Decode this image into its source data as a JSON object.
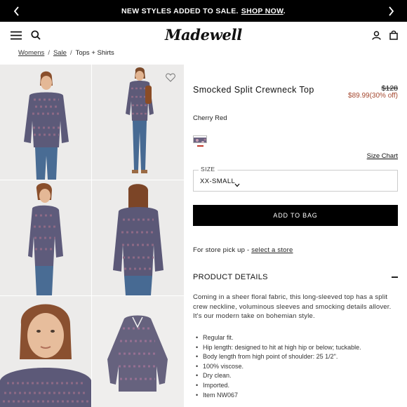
{
  "promo": {
    "text": "NEW STYLES ADDED TO SALE.",
    "link": "SHOP NOW",
    "suffix": "."
  },
  "header": {
    "logo": "Madewell",
    "icons": [
      "menu-icon",
      "search-icon",
      "account-icon",
      "bag-icon"
    ]
  },
  "breadcrumb": {
    "items": [
      "Womens",
      "Sale",
      "Tops + Shirts"
    ],
    "separator": "/"
  },
  "product": {
    "title": "Smocked Split Crewneck Top",
    "original_price": "$128",
    "sale_price": "$89.99(30% off)",
    "color_label": "Cherry Red",
    "size_chart": "Size Chart",
    "size_legend": "SIZE",
    "size_value": "XX-SMALL",
    "add_to_bag": "ADD TO BAG",
    "pickup_text": "For store pick up - ",
    "pickup_link": "select a store",
    "details_heading": "PRODUCT DETAILS",
    "description": "Coming in a sheer floral fabric, this long-sleeved top has a split crew neckline, voluminous sleeves and smocking details allover. It's our modern take on bohemian style.",
    "bullets": [
      "Regular fit.",
      "Hip length: designed to hit at high hip or below; tuckable.",
      "Body length from high point of shoulder: 25 1/2\".",
      "100% viscose.",
      "Dry clean.",
      "Imported.",
      "Item NW067"
    ]
  },
  "colors": {
    "accent_price": "#a4482f",
    "button_bg": "#000000",
    "banner_bg": "#000000"
  }
}
